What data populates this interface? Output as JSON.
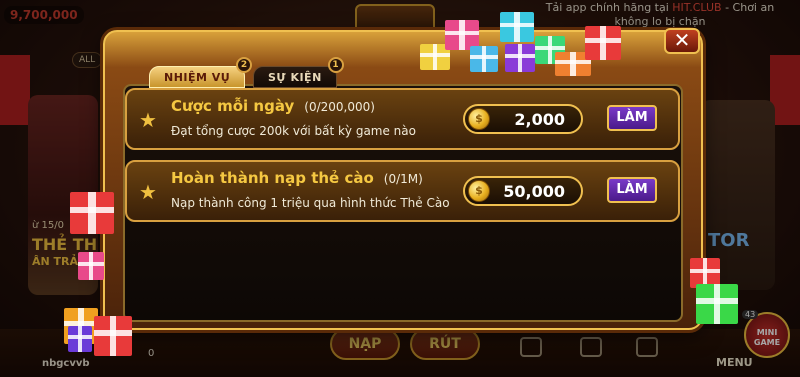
{
  "background": {
    "balance": "9,700,000",
    "notice_line1_prefix": "Tải app chính hãng tại ",
    "notice_line1_brand": "HIT.CLUB",
    "notice_line1_suffix": " - Chơi an",
    "notice_line2": "không lo bị chặn",
    "all_tab": "ALL",
    "promo_date": "ừ 15/0",
    "promo_big": "THẺ TH",
    "promo_small": "ÂN TRẢ",
    "right_game": "TOR",
    "deposit_button": "NẠP",
    "withdraw_button": "RÚT",
    "username": "nbgcvvb",
    "zero_balance": "0",
    "menu_label": "MENU",
    "mini_game_label": "MINI GAME",
    "mini_badge": "43"
  },
  "modal": {
    "close_symbol": "✕",
    "tabs": [
      {
        "label": "NHIỆM VỤ",
        "badge": "2"
      },
      {
        "label": "SỰ KIỆN",
        "badge": "1"
      }
    ],
    "missions": [
      {
        "title": "Cược mỗi ngày",
        "progress": "(0/200,000)",
        "description": "Đạt tổng cược 200k với bất kỳ game nào",
        "reward": "2,000",
        "action": "LÀM"
      },
      {
        "title": "Hoàn thành nạp thẻ cào",
        "progress": "(0/1M)",
        "description": "Nạp thành công 1 triệu qua hình thức Thẻ Cào",
        "reward": "50,000",
        "action": "LÀM"
      }
    ]
  },
  "icons": {
    "star": "star-icon",
    "coin": "coin-icon",
    "close": "close-icon",
    "gift": "gift-box-icon"
  },
  "colors": {
    "accent_gold": "#f0c050",
    "title_yellow": "#f5c842",
    "action_purple": "#6a2ab8",
    "close_red": "#c04020"
  }
}
